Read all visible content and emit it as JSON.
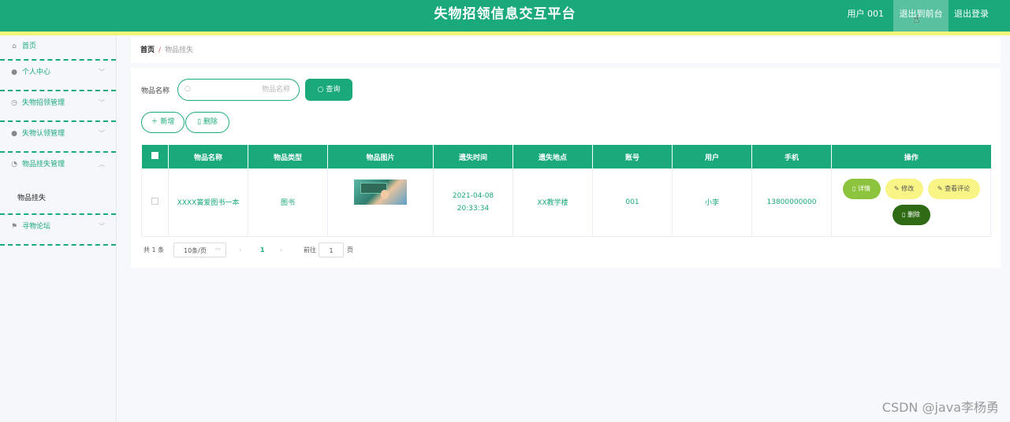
{
  "header": {
    "title": "失物招领信息交互平台",
    "user_label": "用户 001",
    "front_button": "退出到前台",
    "logout_button": "退出登录"
  },
  "sidebar": {
    "items": [
      {
        "label": "首页",
        "icon": "home-icon"
      },
      {
        "label": "个人中心",
        "icon": "user-icon"
      },
      {
        "label": "失物招领管理",
        "icon": "clock-icon"
      },
      {
        "label": "失物认领管理",
        "icon": "user-icon"
      },
      {
        "label": "物品挂失管理",
        "icon": "gauge-icon"
      },
      {
        "label": "寻物论坛",
        "icon": "flag-icon"
      }
    ],
    "sub_item": "物品挂失"
  },
  "breadcrumb": {
    "home": "首页",
    "separator": "/",
    "current": "物品挂失"
  },
  "search": {
    "label": "物品名称",
    "placeholder": "物品名称",
    "query_button": "查询"
  },
  "actions": {
    "add_button": "新增",
    "delete_button": "删除"
  },
  "table": {
    "columns": [
      "物品名称",
      "物品类型",
      "物品图片",
      "遗失时间",
      "遗失地点",
      "账号",
      "用户",
      "手机",
      "操作"
    ],
    "rows": [
      {
        "name": "XXXX簧爱图书一本",
        "type": "图书",
        "lost_time": "2021-04-08 20:33:34",
        "lost_place": "XX教学楼",
        "account": "001",
        "user": "小李",
        "phone": "13800000000"
      }
    ],
    "ops": {
      "detail": "详情",
      "edit": "修改",
      "comments": "查看评论",
      "delete": "删除"
    }
  },
  "pagination": {
    "total": "共 1 条",
    "page_size": "10条/页",
    "current_page": "1",
    "goto_label": "前往",
    "goto_value": "1",
    "page_suffix": "页"
  },
  "watermark": "CSDN @java李杨勇",
  "colors": {
    "primary": "#1aa97b",
    "accent_strip": "#f4f37c",
    "detail_btn": "#8cc43e",
    "edit_btn": "#f9f486",
    "delete_btn": "#2f6b14"
  }
}
